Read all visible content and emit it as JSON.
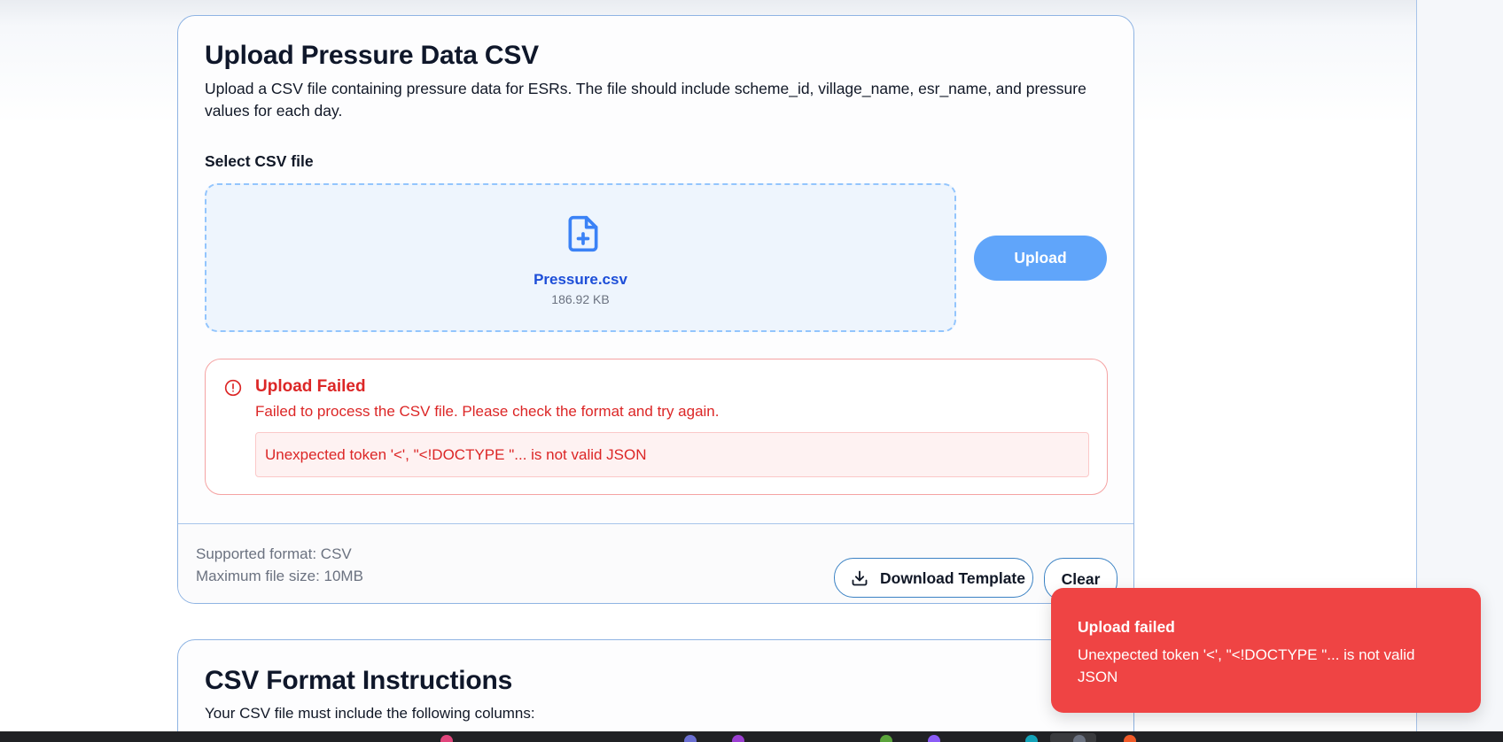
{
  "upload_card": {
    "title": "Upload Pressure Data CSV",
    "description": "Upload a CSV file containing pressure data for ESRs. The file should include scheme_id, village_name, esr_name, and pressure values for each day.",
    "select_label": "Select CSV file",
    "dropzone": {
      "icon": "file-plus-icon",
      "file_name": "Pressure.csv",
      "file_size": "186.92 KB"
    },
    "upload_button": "Upload",
    "error": {
      "icon": "alert-circle-icon",
      "title": "Upload Failed",
      "message": "Failed to process the CSV file. Please check the format and try again.",
      "detail": "Unexpected token '<', \"<!DOCTYPE \"... is not valid JSON"
    },
    "footer": {
      "supported_format": "Supported format: CSV",
      "max_size": "Maximum file size: 10MB",
      "download_template": "Download Template",
      "download_icon": "download-icon",
      "clear": "Clear"
    }
  },
  "instructions_card": {
    "title": "CSV Format Instructions",
    "description": "Your CSV file must include the following columns:"
  },
  "toast": {
    "title": "Upload failed",
    "message": "Unexpected token '<', \"<!DOCTYPE \"... is not valid JSON"
  },
  "colors": {
    "primary": "#60a5fa",
    "error": "#ef4444",
    "error_text": "#dc2626",
    "border": "#8fb4e3",
    "file_name": "#1d4ed8"
  }
}
